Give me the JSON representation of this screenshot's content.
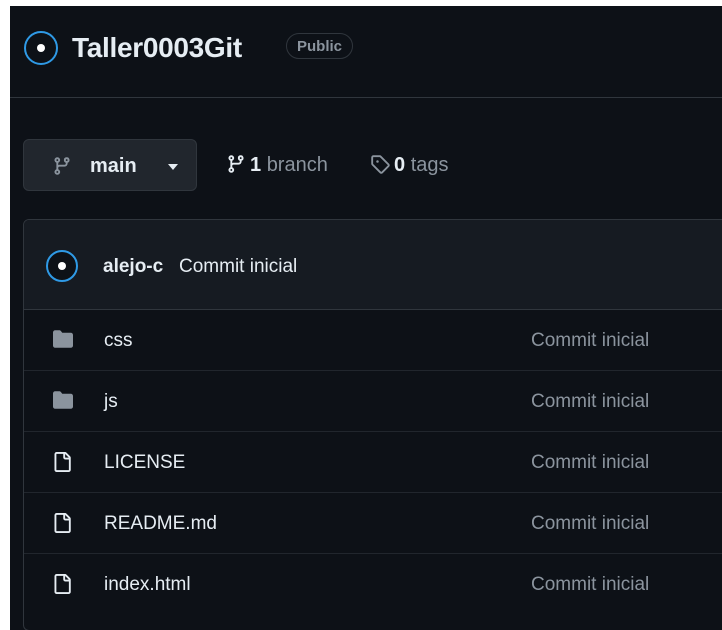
{
  "repo": {
    "name": "Taller0003Git",
    "visibility": "Public"
  },
  "branch_bar": {
    "current_branch": "main",
    "branch_count": "1",
    "branch_label": "branch",
    "tag_count": "0",
    "tag_label": "tags"
  },
  "latest_commit": {
    "author": "alejo-c",
    "message": "Commit inicial"
  },
  "files": [
    {
      "name": "css",
      "type": "folder",
      "icon": "folder-icon",
      "commit": "Commit inicial"
    },
    {
      "name": "js",
      "type": "folder",
      "icon": "folder-icon",
      "commit": "Commit inicial"
    },
    {
      "name": "LICENSE",
      "type": "file",
      "icon": "file-icon",
      "commit": "Commit inicial"
    },
    {
      "name": "README.md",
      "type": "file",
      "icon": "file-icon",
      "commit": "Commit inicial"
    },
    {
      "name": "index.html",
      "type": "file",
      "icon": "file-icon",
      "commit": "Commit inicial"
    }
  ],
  "colors": {
    "background": "#0d1117",
    "border": "#30363d",
    "text": "#e6edf3",
    "muted": "#8b949e",
    "avatar_ring": "#2f9ae6"
  }
}
